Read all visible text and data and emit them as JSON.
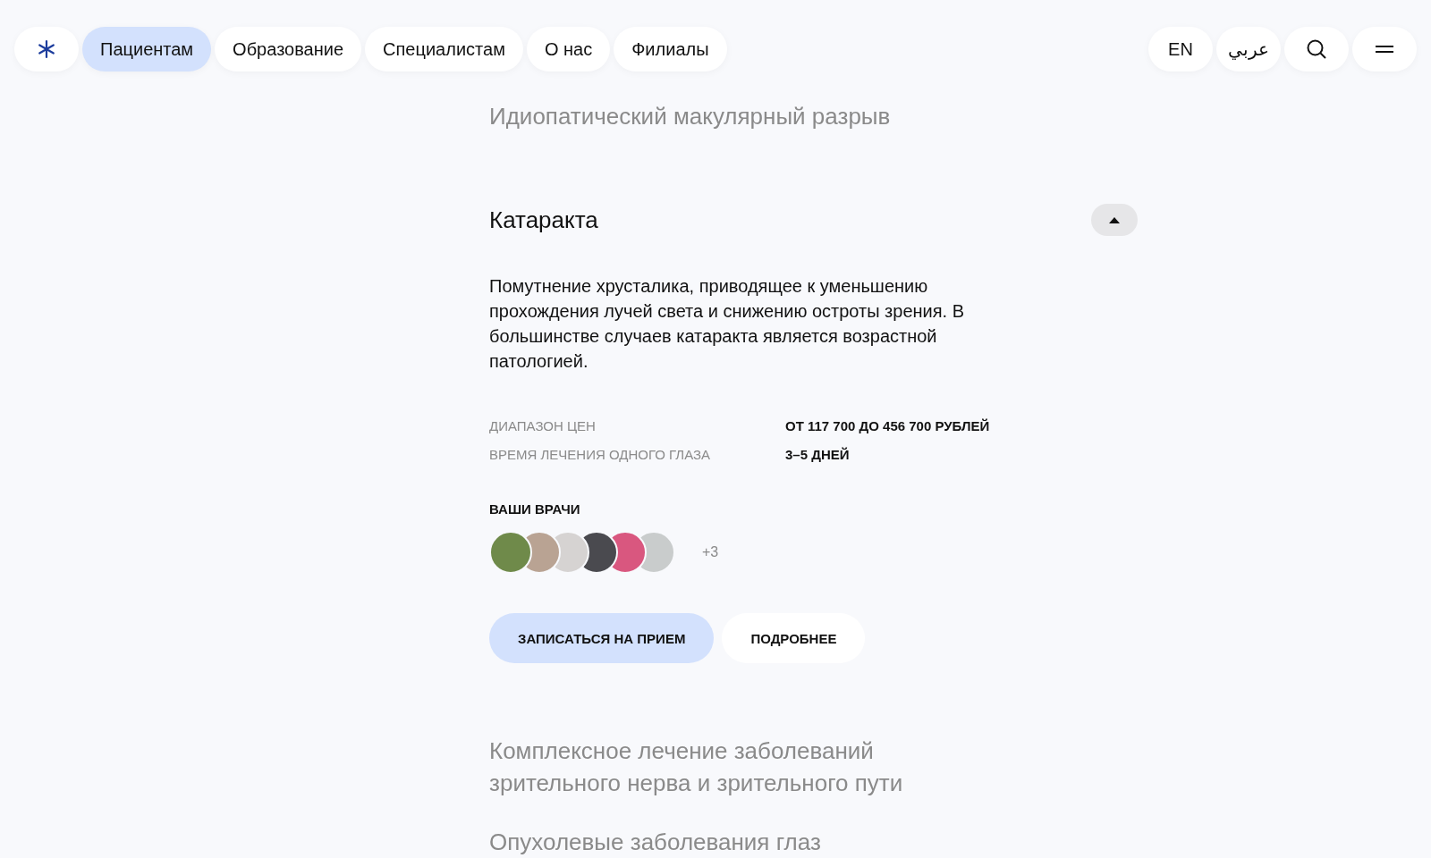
{
  "nav": {
    "items": [
      {
        "label": "Пациентам",
        "selected": true
      },
      {
        "label": "Образование",
        "selected": false
      },
      {
        "label": "Специалистам",
        "selected": false
      },
      {
        "label": "О нас",
        "selected": false
      },
      {
        "label": "Филиалы",
        "selected": false
      }
    ],
    "languages": [
      "EN",
      "عربي"
    ]
  },
  "sections": [
    {
      "title": "Идиопатический макулярный разрыв",
      "expanded": false
    },
    {
      "title": "Катаракта",
      "expanded": true,
      "description": "Помутнение хрусталика, приводящее к уменьшению прохождения лучей света и снижению остроты зрения. В большинстве случаев катаракта является возрастной патологией.",
      "details": [
        {
          "label": "ДИАПАЗОН ЦЕН",
          "value": "ОТ 117 700 ДО 456 700 РУБЛЕЙ"
        },
        {
          "label": "ВРЕМЯ ЛЕЧЕНИЯ ОДНОГО ГЛАЗА",
          "value": "3–5 ДНЕЙ"
        }
      ],
      "doctors": {
        "heading": "ВАШИ ВРАЧИ",
        "more": "+3"
      },
      "buttons": [
        {
          "label": "ЗАПИСАТЬСЯ НА ПРИЕМ",
          "kind": "primary"
        },
        {
          "label": "ПОДРОБНЕЕ",
          "kind": "secondary"
        }
      ]
    },
    {
      "title": "Комплексное лечение заболеваний зрительного нерва и зрительного пути",
      "expanded": false
    },
    {
      "title": "Опухолевые заболевания глаз",
      "expanded": false
    }
  ]
}
